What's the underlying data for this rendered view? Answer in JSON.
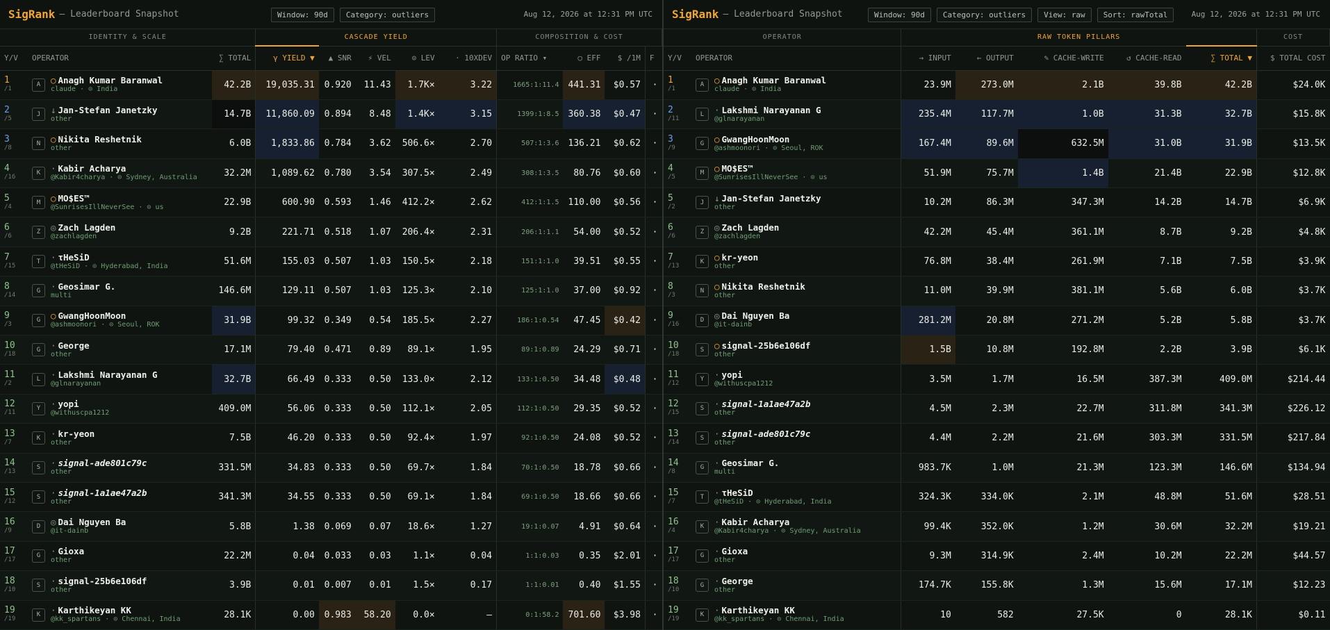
{
  "brand": "SigRank",
  "subtitle": "— Leaderboard Snapshot",
  "timestamp": "Aug 12, 2026 at 12:31 PM UTC",
  "left": {
    "chips": [
      "Window: 90d",
      "Category: outliers"
    ],
    "groups": [
      "IDENTITY & SCALE",
      "CASCADE YIELD",
      "COMPOSITION & COST"
    ],
    "columns": [
      "Y/V",
      "OPERATOR",
      "∑ TOTAL",
      "γ YIELD ▼",
      "▲ SNR",
      "⚡ VEL",
      "⊙ LEV",
      "· 10XDEV",
      "OP RATIO ▾",
      "○ EFF",
      "$ /1M",
      "F"
    ],
    "rows": [
      {
        "r": "1",
        "s": "/1",
        "av": "A",
        "m": "○",
        "name": "Anagh Kumar Baranwal",
        "sub": "claude · ⊙ India",
        "total": "42.2B",
        "yield": "19,035.31",
        "snr": "0.920",
        "vel": "11.43",
        "lev": "1.7K×",
        "dev": "3.22",
        "ratio": "1665:1:11.4",
        "eff": "441.31",
        "cost": "$0.57",
        "f": "·"
      },
      {
        "r": "2",
        "s": "/5",
        "av": "J",
        "m": "↓",
        "name": "Jan-Stefan Janetzky",
        "sub": "other",
        "total": "14.7B",
        "yield": "11,860.09",
        "snr": "0.894",
        "vel": "8.48",
        "lev": "1.4K×",
        "dev": "3.15",
        "ratio": "1399:1:8.5",
        "eff": "360.38",
        "cost": "$0.47",
        "f": "·"
      },
      {
        "r": "3",
        "s": "/8",
        "av": "N",
        "m": "○",
        "name": "Nikita Reshetnik",
        "sub": "other",
        "total": "6.0B",
        "yield": "1,833.86",
        "snr": "0.784",
        "vel": "3.62",
        "lev": "506.6×",
        "dev": "2.70",
        "ratio": "507:1:3.6",
        "eff": "136.21",
        "cost": "$0.62",
        "f": "·"
      },
      {
        "r": "4",
        "s": "/16",
        "av": "K",
        "m": "·",
        "name": "Kabir Acharya",
        "sub": "@Kabir4charya · ⊙ Sydney, Australia",
        "total": "32.2M",
        "yield": "1,089.62",
        "snr": "0.780",
        "vel": "3.54",
        "lev": "307.5×",
        "dev": "2.49",
        "ratio": "308:1:3.5",
        "eff": "80.76",
        "cost": "$0.60",
        "f": "·"
      },
      {
        "r": "5",
        "s": "/4",
        "av": "M",
        "m": "○",
        "name": "MO$ES™",
        "sub": "@SunrisesIllNeverSee · ⊙ us",
        "total": "22.9B",
        "yield": "600.90",
        "snr": "0.593",
        "vel": "1.46",
        "lev": "412.2×",
        "dev": "2.62",
        "ratio": "412:1:1.5",
        "eff": "110.00",
        "cost": "$0.56",
        "f": "·"
      },
      {
        "r": "6",
        "s": "/6",
        "av": "Z",
        "m": "◎",
        "name": "Zach Lagden",
        "sub": "@zachlagden",
        "total": "9.2B",
        "yield": "221.71",
        "snr": "0.518",
        "vel": "1.07",
        "lev": "206.4×",
        "dev": "2.31",
        "ratio": "206:1:1.1",
        "eff": "54.00",
        "cost": "$0.52",
        "f": "·"
      },
      {
        "r": "7",
        "s": "/15",
        "av": "T",
        "m": "·",
        "name": "τHeSiD",
        "sub": "@tHeSiD · ⊙ Hyderabad, India",
        "total": "51.6M",
        "yield": "155.03",
        "snr": "0.507",
        "vel": "1.03",
        "lev": "150.5×",
        "dev": "2.18",
        "ratio": "151:1:1.0",
        "eff": "39.51",
        "cost": "$0.55",
        "f": "·"
      },
      {
        "r": "8",
        "s": "/14",
        "av": "G",
        "m": "·",
        "name": "Geosimar G.",
        "sub": "multi",
        "total": "146.6M",
        "yield": "129.11",
        "snr": "0.507",
        "vel": "1.03",
        "lev": "125.3×",
        "dev": "2.10",
        "ratio": "125:1:1.0",
        "eff": "37.00",
        "cost": "$0.92",
        "f": "·"
      },
      {
        "r": "9",
        "s": "/3",
        "av": "G",
        "m": "○",
        "name": "GwangHoonMoon",
        "sub": "@ashmoonori · ⊙ Seoul, ROK",
        "total": "31.9B",
        "yield": "99.32",
        "snr": "0.349",
        "vel": "0.54",
        "lev": "185.5×",
        "dev": "2.27",
        "ratio": "186:1:0.54",
        "eff": "47.45",
        "cost": "$0.42",
        "f": "·"
      },
      {
        "r": "10",
        "s": "/18",
        "av": "G",
        "m": "·",
        "name": "George",
        "sub": "other",
        "total": "17.1M",
        "yield": "79.40",
        "snr": "0.471",
        "vel": "0.89",
        "lev": "89.1×",
        "dev": "1.95",
        "ratio": "89:1:0.89",
        "eff": "24.29",
        "cost": "$0.71",
        "f": "·"
      },
      {
        "r": "11",
        "s": "/2",
        "av": "L",
        "m": "·",
        "name": "Lakshmi Narayanan G",
        "sub": "@glnarayanan",
        "total": "32.7B",
        "yield": "66.49",
        "snr": "0.333",
        "vel": "0.50",
        "lev": "133.0×",
        "dev": "2.12",
        "ratio": "133:1:0.50",
        "eff": "34.48",
        "cost": "$0.48",
        "f": "·"
      },
      {
        "r": "12",
        "s": "/11",
        "av": "Y",
        "m": "·",
        "name": "yopi",
        "sub": "@withuscpa1212",
        "total": "409.0M",
        "yield": "56.06",
        "snr": "0.333",
        "vel": "0.50",
        "lev": "112.1×",
        "dev": "2.05",
        "ratio": "112:1:0.50",
        "eff": "29.35",
        "cost": "$0.52",
        "f": "·"
      },
      {
        "r": "13",
        "s": "/7",
        "av": "K",
        "m": "·",
        "name": "kr-yeon",
        "sub": "other",
        "total": "7.5B",
        "yield": "46.20",
        "snr": "0.333",
        "vel": "0.50",
        "lev": "92.4×",
        "dev": "1.97",
        "ratio": "92:1:0.50",
        "eff": "24.08",
        "cost": "$0.52",
        "f": "·"
      },
      {
        "r": "14",
        "s": "/13",
        "av": "S",
        "m": "·",
        "name": "signal-ade801c79c",
        "sub": "other",
        "total": "331.5M",
        "yield": "34.83",
        "snr": "0.333",
        "vel": "0.50",
        "lev": "69.7×",
        "dev": "1.84",
        "ratio": "70:1:0.50",
        "eff": "18.78",
        "cost": "$0.66",
        "f": "·",
        "ital": true
      },
      {
        "r": "15",
        "s": "/12",
        "av": "S",
        "m": "·",
        "name": "signal-1a1ae47a2b",
        "sub": "other",
        "total": "341.3M",
        "yield": "34.55",
        "snr": "0.333",
        "vel": "0.50",
        "lev": "69.1×",
        "dev": "1.84",
        "ratio": "69:1:0.50",
        "eff": "18.66",
        "cost": "$0.66",
        "f": "·",
        "ital": true
      },
      {
        "r": "16",
        "s": "/9",
        "av": "D",
        "m": "◎",
        "name": "Dai Nguyen Ba",
        "sub": "@it-dainb",
        "total": "5.8B",
        "yield": "1.38",
        "snr": "0.069",
        "vel": "0.07",
        "lev": "18.6×",
        "dev": "1.27",
        "ratio": "19:1:0.07",
        "eff": "4.91",
        "cost": "$0.64",
        "f": "·"
      },
      {
        "r": "17",
        "s": "/17",
        "av": "G",
        "m": "·",
        "name": "Gioxa",
        "sub": "other",
        "total": "22.2M",
        "yield": "0.04",
        "snr": "0.033",
        "vel": "0.03",
        "lev": "1.1×",
        "dev": "0.04",
        "ratio": "1:1:0.03",
        "eff": "0.35",
        "cost": "$2.01",
        "f": "·"
      },
      {
        "r": "18",
        "s": "/10",
        "av": "S",
        "m": "·",
        "name": "signal-25b6e106df",
        "sub": "other",
        "total": "3.9B",
        "yield": "0.01",
        "snr": "0.007",
        "vel": "0.01",
        "lev": "1.5×",
        "dev": "0.17",
        "ratio": "1:1:0.01",
        "eff": "0.40",
        "cost": "$1.55",
        "f": "·"
      },
      {
        "r": "19",
        "s": "/19",
        "av": "K",
        "m": "·",
        "name": "Karthikeyan KK",
        "sub": "@kk_spartans · ⊙ Chennai, India",
        "total": "28.1K",
        "yield": "0.00",
        "snr": "0.983",
        "vel": "58.20",
        "lev": "0.0×",
        "dev": "—",
        "ratio": "0:1:58.2",
        "eff": "701.60",
        "cost": "$3.98",
        "f": "·"
      }
    ]
  },
  "right": {
    "chips": [
      "Window: 90d",
      "Category: outliers",
      "View: raw",
      "Sort: rawTotal"
    ],
    "groups": [
      "OPERATOR",
      "RAW TOKEN PILLARS",
      "COST"
    ],
    "columns": [
      "Y/V",
      "OPERATOR",
      "→ INPUT",
      "← OUTPUT",
      "✎ CACHE-WRITE",
      "↺ CACHE-READ",
      "∑ TOTAL ▼",
      "$ TOTAL COST"
    ],
    "rows": [
      {
        "r": "1",
        "s": "/1",
        "av": "A",
        "m": "○",
        "name": "Anagh Kumar Baranwal",
        "sub": "claude · ⊙ India",
        "input": "23.9M",
        "output": "273.0M",
        "cw": "2.1B",
        "cr": "39.8B",
        "total": "42.2B",
        "cost": "$24.0K"
      },
      {
        "r": "2",
        "s": "/11",
        "av": "L",
        "m": "·",
        "name": "Lakshmi Narayanan G",
        "sub": "@glnarayanan",
        "input": "235.4M",
        "output": "117.7M",
        "cw": "1.0B",
        "cr": "31.3B",
        "total": "32.7B",
        "cost": "$15.8K"
      },
      {
        "r": "3",
        "s": "/9",
        "av": "G",
        "m": "○",
        "name": "GwangHoonMoon",
        "sub": "@ashmoonori · ⊙ Seoul, ROK",
        "input": "167.4M",
        "output": "89.6M",
        "cw": "632.5M",
        "cr": "31.0B",
        "total": "31.9B",
        "cost": "$13.5K"
      },
      {
        "r": "4",
        "s": "/5",
        "av": "M",
        "m": "○",
        "name": "MO$ES™",
        "sub": "@SunrisesIllNeverSee · ⊙ us",
        "input": "51.9M",
        "output": "75.7M",
        "cw": "1.4B",
        "cr": "21.4B",
        "total": "22.9B",
        "cost": "$12.8K"
      },
      {
        "r": "5",
        "s": "/2",
        "av": "J",
        "m": "↓",
        "name": "Jan-Stefan Janetzky",
        "sub": "other",
        "input": "10.2M",
        "output": "86.3M",
        "cw": "347.3M",
        "cr": "14.2B",
        "total": "14.7B",
        "cost": "$6.9K"
      },
      {
        "r": "6",
        "s": "/6",
        "av": "Z",
        "m": "◎",
        "name": "Zach Lagden",
        "sub": "@zachlagden",
        "input": "42.2M",
        "output": "45.4M",
        "cw": "361.1M",
        "cr": "8.7B",
        "total": "9.2B",
        "cost": "$4.8K"
      },
      {
        "r": "7",
        "s": "/13",
        "av": "K",
        "m": "○",
        "name": "kr-yeon",
        "sub": "other",
        "input": "76.8M",
        "output": "38.4M",
        "cw": "261.9M",
        "cr": "7.1B",
        "total": "7.5B",
        "cost": "$3.9K"
      },
      {
        "r": "8",
        "s": "/3",
        "av": "N",
        "m": "○",
        "name": "Nikita Reshetnik",
        "sub": "other",
        "input": "11.0M",
        "output": "39.9M",
        "cw": "381.1M",
        "cr": "5.6B",
        "total": "6.0B",
        "cost": "$3.7K"
      },
      {
        "r": "9",
        "s": "/16",
        "av": "D",
        "m": "◎",
        "name": "Dai Nguyen Ba",
        "sub": "@it-dainb",
        "input": "281.2M",
        "output": "20.8M",
        "cw": "271.2M",
        "cr": "5.2B",
        "total": "5.8B",
        "cost": "$3.7K"
      },
      {
        "r": "10",
        "s": "/18",
        "av": "S",
        "m": "○",
        "name": "signal-25b6e106df",
        "sub": "other",
        "input": "1.5B",
        "output": "10.8M",
        "cw": "192.8M",
        "cr": "2.2B",
        "total": "3.9B",
        "cost": "$6.1K"
      },
      {
        "r": "11",
        "s": "/12",
        "av": "Y",
        "m": "·",
        "name": "yopi",
        "sub": "@withuscpa1212",
        "input": "3.5M",
        "output": "1.7M",
        "cw": "16.5M",
        "cr": "387.3M",
        "total": "409.0M",
        "cost": "$214.44"
      },
      {
        "r": "12",
        "s": "/15",
        "av": "S",
        "m": "·",
        "name": "signal-1a1ae47a2b",
        "sub": "other",
        "input": "4.5M",
        "output": "2.3M",
        "cw": "22.7M",
        "cr": "311.8M",
        "total": "341.3M",
        "cost": "$226.12",
        "ital": true
      },
      {
        "r": "13",
        "s": "/14",
        "av": "S",
        "m": "·",
        "name": "signal-ade801c79c",
        "sub": "other",
        "input": "4.4M",
        "output": "2.2M",
        "cw": "21.6M",
        "cr": "303.3M",
        "total": "331.5M",
        "cost": "$217.84",
        "ital": true
      },
      {
        "r": "14",
        "s": "/8",
        "av": "G",
        "m": "·",
        "name": "Geosimar G.",
        "sub": "multi",
        "input": "983.7K",
        "output": "1.0M",
        "cw": "21.3M",
        "cr": "123.3M",
        "total": "146.6M",
        "cost": "$134.94"
      },
      {
        "r": "15",
        "s": "/7",
        "av": "T",
        "m": "·",
        "name": "τHeSiD",
        "sub": "@tHeSiD · ⊙ Hyderabad, India",
        "input": "324.3K",
        "output": "334.0K",
        "cw": "2.1M",
        "cr": "48.8M",
        "total": "51.6M",
        "cost": "$28.51"
      },
      {
        "r": "16",
        "s": "/4",
        "av": "K",
        "m": "·",
        "name": "Kabir Acharya",
        "sub": "@Kabir4charya · ⊙ Sydney, Australia",
        "input": "99.4K",
        "output": "352.0K",
        "cw": "1.2M",
        "cr": "30.6M",
        "total": "32.2M",
        "cost": "$19.21"
      },
      {
        "r": "17",
        "s": "/17",
        "av": "G",
        "m": "·",
        "name": "Gioxa",
        "sub": "other",
        "input": "9.3M",
        "output": "314.9K",
        "cw": "2.4M",
        "cr": "10.2M",
        "total": "22.2M",
        "cost": "$44.57"
      },
      {
        "r": "18",
        "s": "/10",
        "av": "G",
        "m": "·",
        "name": "George",
        "sub": "other",
        "input": "174.7K",
        "output": "155.8K",
        "cw": "1.3M",
        "cr": "15.6M",
        "total": "17.1M",
        "cost": "$12.23"
      },
      {
        "r": "19",
        "s": "/19",
        "av": "K",
        "m": "·",
        "name": "Karthikeyan KK",
        "sub": "@kk_spartans · ⊙ Chennai, India",
        "input": "10",
        "output": "582",
        "cw": "27.5K",
        "cr": "0",
        "total": "28.1K",
        "cost": "$0.11"
      }
    ]
  }
}
